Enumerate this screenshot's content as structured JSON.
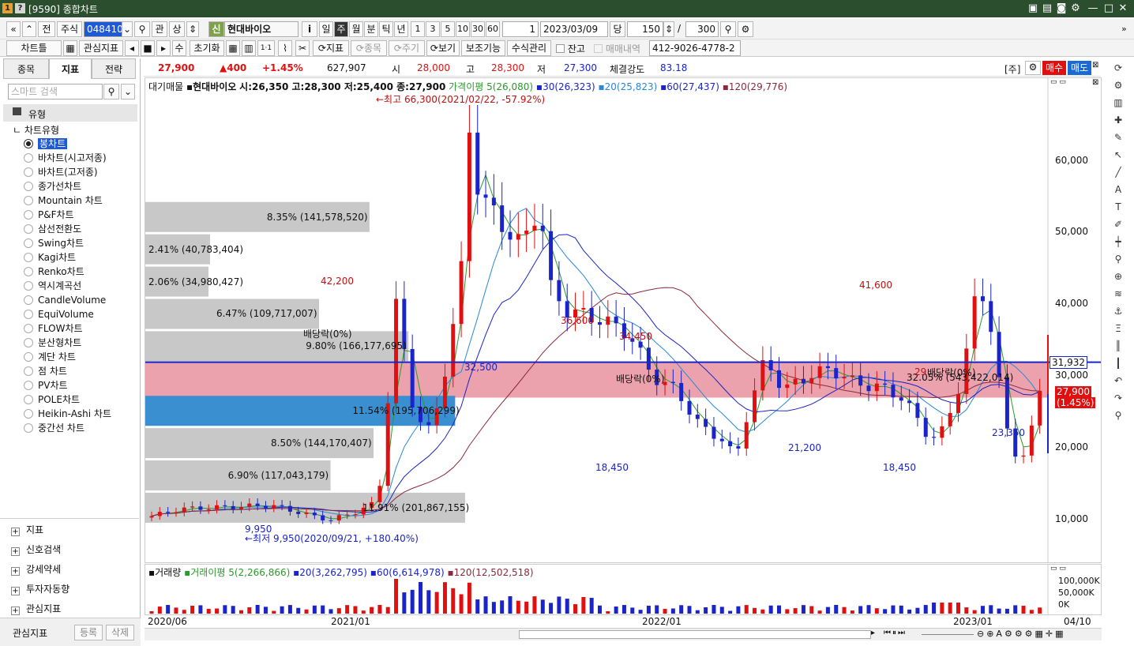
{
  "window": {
    "title": "[9590] 종합차트",
    "badge1": "1",
    "badge2": "?"
  },
  "toolbar": {
    "nav_first": "«",
    "nav_up": "«",
    "prev": "전",
    "market": "주식",
    "code": "048410",
    "search_icon": "search-icon",
    "kwan": "관",
    "sang": "상",
    "shin": "신",
    "stock_name": "현대바이오",
    "info": "i",
    "periods": [
      "일",
      "주",
      "월",
      "분",
      "틱",
      "년"
    ],
    "selected_period": "주",
    "minutes": [
      "1",
      "3",
      "5",
      "10",
      "30",
      "60"
    ],
    "unit": "1",
    "date": "2023/03/09",
    "dang": "당",
    "count": "150",
    "slash": "/",
    "max": "300"
  },
  "toolbar2": {
    "chart_tool": "차트틀",
    "interest": "관심지표",
    "su": "수",
    "reset": "초기화",
    "indicator": "지표",
    "item": "종목",
    "period": "주기",
    "view": "보기",
    "aux": "보조기능",
    "formula": "수식관리",
    "balance": "잔고",
    "trades": "매매내역",
    "account": "412-9026-4778-2"
  },
  "left": {
    "tabs": [
      "종목",
      "지표",
      "전략"
    ],
    "selected_tab": "지표",
    "search_placeholder": "스마트 검색",
    "group": "유형",
    "subgroup": "차트유형",
    "chart_types": [
      "봉차트",
      "바차트(시고저종)",
      "바차트(고저종)",
      "종가선차트",
      "Mountain 차트",
      "P&F차트",
      "삼선전환도",
      "Swing차트",
      "Kagi차트",
      "Renko차트",
      "역시계곡선",
      "CandleVolume",
      "EquiVolume",
      "FLOW차트",
      "분산형차트",
      "계단 차트",
      "점 차트",
      "PV차트",
      "POLE차트",
      "Heikin-Ashi 차트",
      "중간선 차트"
    ],
    "sections": [
      "지표",
      "신호검색",
      "강세약세",
      "투자자동향",
      "관심지표"
    ],
    "bottom_label": "관심지표",
    "register": "등록",
    "delete": "삭제"
  },
  "quote": {
    "price": "27,900",
    "change": "▲400",
    "pct": "+1.45%",
    "volume": "627,907",
    "open_label": "시",
    "open": "28,000",
    "high_label": "고",
    "high": "28,300",
    "low_label": "저",
    "low": "27,300",
    "strength_label": "체결강도",
    "strength": "83.18",
    "ju": "[주]",
    "buy": "매수",
    "sell": "매도"
  },
  "legend": {
    "main": "대기매물",
    "name": "현대바이오",
    "ohlc": "시:26,350 고:28,300 저:25,400 종:27,900",
    "ma5": "가격이평 5(26,080)",
    "ma30": "30(26,323)",
    "ma20": "20(25,823)",
    "ma60": "60(27,437)",
    "ma120": "120(29,776)"
  },
  "annotations": {
    "top": "←최고 66,300(2021/02/22, -57.92%)",
    "bottom": "←최저 9,950(2020/09/21, +180.40%)",
    "p42200": "42,200",
    "p36600": "36,600",
    "p34450": "34,450",
    "p32500": "32,500",
    "p41600": "41,600",
    "p18450a": "18,450",
    "p21200": "21,200",
    "p18450b": "18,450",
    "p23350": "23,350",
    "p9950": "9,950",
    "div1": "배당락(0%)",
    "div2": "배당락(0%)",
    "div3": "배당락(0%)",
    "pct29": "29"
  },
  "volume_profile": [
    {
      "label": "8.35% (141,578,520)",
      "pct": 8.35,
      "price": 52000
    },
    {
      "label": "2.41% (40,783,404)",
      "pct": 2.41,
      "price": 47500
    },
    {
      "label": "2.06% (34,980,427)",
      "pct": 2.06,
      "price": 43000
    },
    {
      "label": "6.47% (109,717,007)",
      "pct": 6.47,
      "price": 38500
    },
    {
      "label": "9.80% (166,177,695)",
      "pct": 9.8,
      "price": 34000
    },
    {
      "label": "32.05% (543,422,014)",
      "pct": 32.05,
      "price": 29500
    },
    {
      "label": "11.54% (195,706,299)",
      "pct": 11.54,
      "price": 25000
    },
    {
      "label": "8.50% (144,170,407)",
      "pct": 8.5,
      "price": 20500
    },
    {
      "label": "6.90% (117,043,179)",
      "pct": 6.9,
      "price": 16000
    },
    {
      "label": "11.91% (201,867,155)",
      "pct": 11.91,
      "price": 11500
    }
  ],
  "price_axis": {
    "ticks": [
      "60,000",
      "50,000",
      "40,000",
      "30,000",
      "20,000",
      "10,000"
    ],
    "current": "27,900",
    "current_pct": "(1.45%)",
    "line_value": "31,932"
  },
  "volume_panel": {
    "title": "거래량",
    "ma5": "거래이평 5(2,266,866)",
    "ma20": "20(3,262,795)",
    "ma60": "60(6,614,978)",
    "ma120": "120(12,502,518)",
    "ticks": [
      "100,000K",
      "50,000K",
      "0K"
    ]
  },
  "x_axis": {
    "labels": [
      "2020/06",
      "2021/01",
      "2022/01",
      "2023/01"
    ],
    "last": "04/10"
  },
  "colors": {
    "up": "#e01010",
    "down": "#1a24c8",
    "highlight": "#e8929e",
    "poc": "#3a8fd0"
  }
}
